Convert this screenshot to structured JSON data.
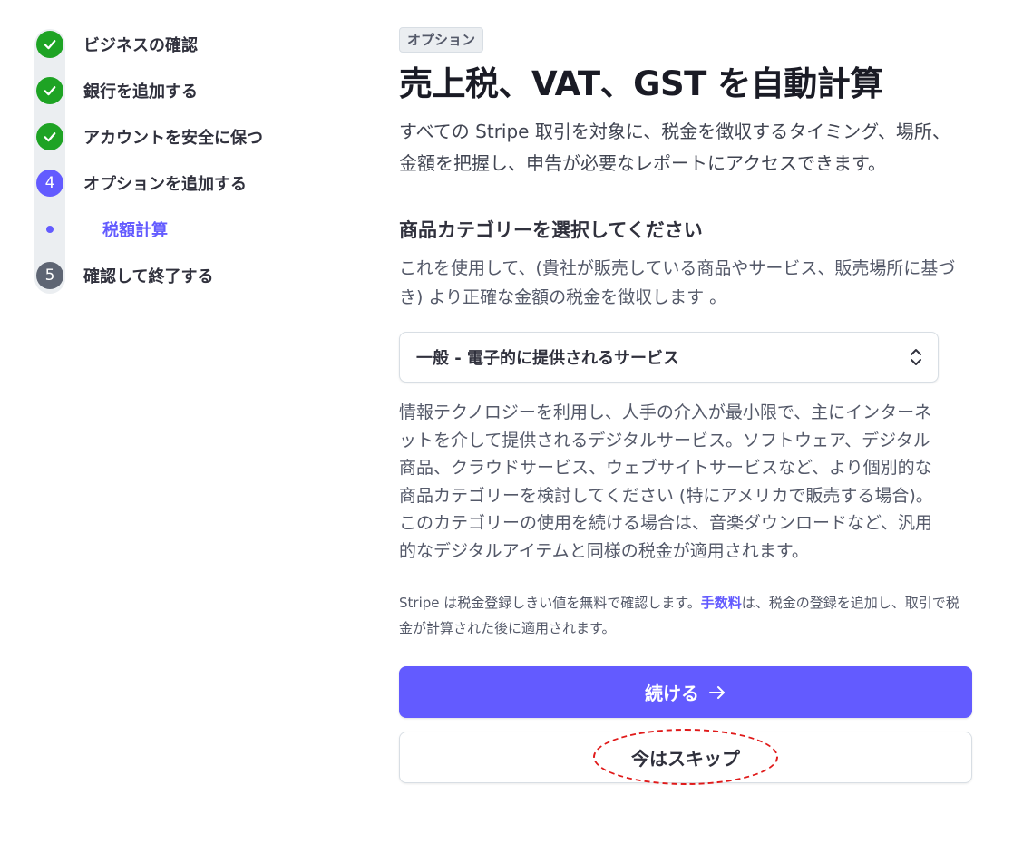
{
  "sidebar": {
    "steps": [
      {
        "label": "ビジネスの確認",
        "status": "done",
        "icon": "check-icon"
      },
      {
        "label": "銀行を追加する",
        "status": "done",
        "icon": "check-icon"
      },
      {
        "label": "アカウントを安全に保つ",
        "status": "done",
        "icon": "check-icon"
      },
      {
        "label": "オプションを追加する",
        "status": "current",
        "number": "4"
      },
      {
        "label": "確認して終了する",
        "status": "todo",
        "number": "5"
      }
    ],
    "substep": {
      "label": "税額計算"
    }
  },
  "main": {
    "badge": "オプション",
    "title": "売上税、VAT、GST を自動計算",
    "lead": "すべての Stripe 取引を対象に、税金を徴収するタイミング、場所、金額を把握し、申告が必要なレポートにアクセスできます。",
    "section_title": "商品カテゴリーを選択してください",
    "section_desc": "これを使用して、(貴社が販売している商品やサービス、販売場所に基づき) より正確な金額の税金を徴収します 。",
    "select_value": "一般 - 電子的に提供されるサービス",
    "category_desc": "情報テクノロジーを利用し、人手の介入が最小限で、主にインターネットを介して提供されるデジタルサービス。ソフトウェア、デジタル商品、クラウドサービス、ウェブサイトサービスなど、より個別的な商品カテゴリーを検討してください (特にアメリカで販売する場合)。このカテゴリーの使用を続ける場合は、音楽ダウンロードなど、汎用的なデジタルアイテムと同様の税金が適用されます。",
    "note_before": "Stripe は税金登録しきい値を無料で確認します。",
    "note_link": "手数料",
    "note_after": "は、税金の登録を追加し、取引で税金が計算された後に適用されます。",
    "continue_label": "続ける",
    "skip_label": "今はスキップ"
  },
  "colors": {
    "accent": "#635bff",
    "done": "#1ea324",
    "todo": "#5e6573",
    "highlight": "#e01a1a"
  }
}
